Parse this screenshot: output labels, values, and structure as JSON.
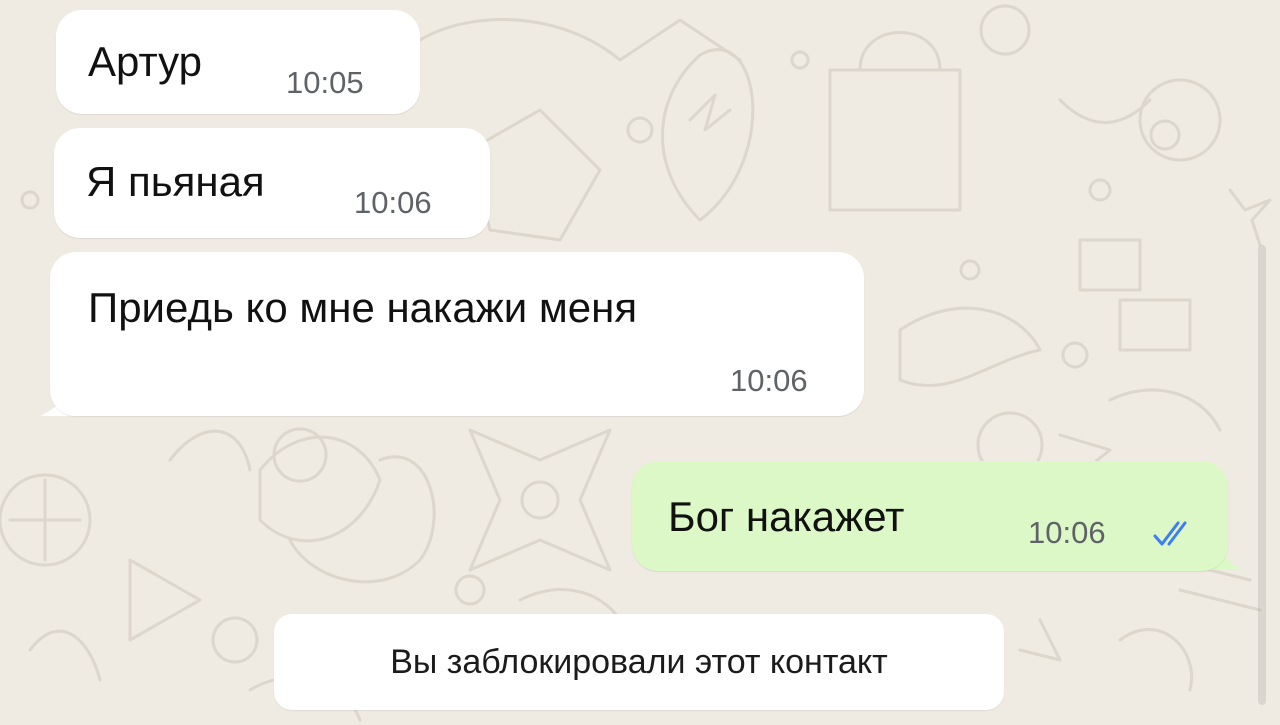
{
  "colors": {
    "wallpaper": "#efeae2",
    "incoming_bubble": "#ffffff",
    "outgoing_bubble": "#dcf8c6",
    "read_ticks": "#3d7df6"
  },
  "messages": [
    {
      "direction": "incoming",
      "text": "Артур",
      "time": "10:05"
    },
    {
      "direction": "incoming",
      "text": "Я пьяная",
      "time": "10:06"
    },
    {
      "direction": "incoming",
      "text": "Приедь  ко мне накажи меня",
      "time": "10:06"
    },
    {
      "direction": "outgoing",
      "text": "Бог накажет",
      "time": "10:06",
      "status_icon": "double-check-icon"
    }
  ],
  "system_notice": "Вы заблокировали этот контакт"
}
